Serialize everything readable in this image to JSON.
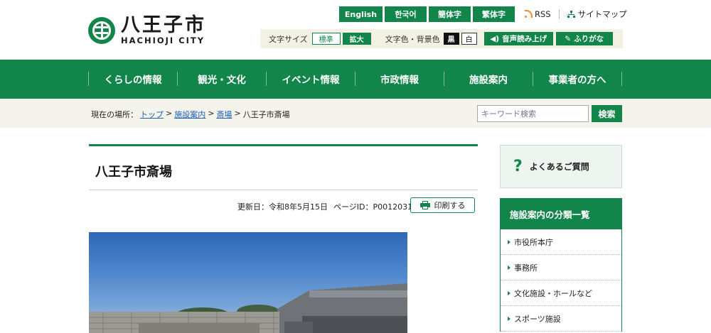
{
  "header": {
    "logo_jp": "八王子市",
    "logo_en": "HACHIOJI CITY",
    "languages": [
      "English",
      "한국어",
      "簡体字",
      "繁体字"
    ],
    "rss_label": "RSS",
    "sitemap_label": "サイトマップ"
  },
  "tools": {
    "text_size_label": "文字サイズ",
    "size_standard": "標準",
    "size_large": "拡大",
    "color_label": "文字色・背景色",
    "color_black": "黒",
    "color_white": "白",
    "read_aloud": "音声読み上げ",
    "furigana": "ふりがな"
  },
  "nav": {
    "items": [
      "くらしの情報",
      "観光・文化",
      "イベント情報",
      "市政情報",
      "施設案内",
      "事業者の方へ"
    ]
  },
  "breadcrumb": {
    "prefix": "現在の場所：",
    "items": [
      "トップ",
      "施設案内",
      "斎場"
    ],
    "current": "八王子市斎場",
    "separator": ">"
  },
  "search": {
    "placeholder": "キーワード検索",
    "button": "検索"
  },
  "page": {
    "title": "八王子市斎場",
    "updated": "更新日：令和8年5月15日",
    "page_id": "ページID：P0012031",
    "print_label": "印刷する"
  },
  "sidebar": {
    "faq_label": "よくあるご質問",
    "category_heading": "施設案内の分類一覧",
    "categories": [
      "市役所本庁",
      "事務所",
      "文化施設・ホールなど",
      "スポーツ施設"
    ]
  },
  "colors": {
    "brand_green": "#12854a",
    "light_bg": "#f4f3ec"
  }
}
